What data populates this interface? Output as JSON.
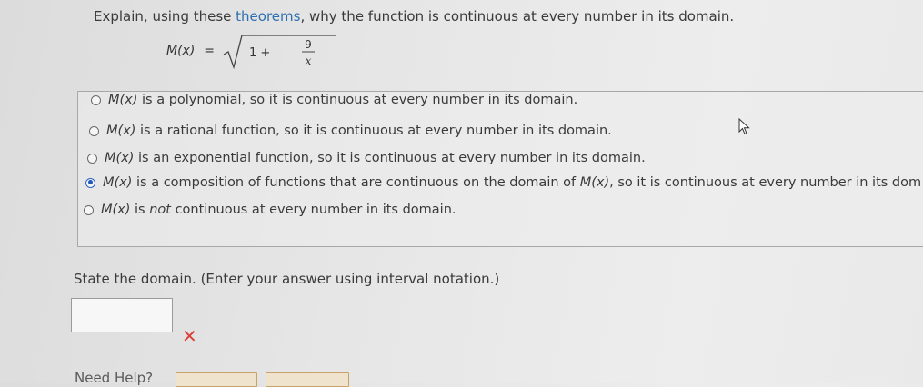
{
  "question": {
    "before_link": "Explain, using these ",
    "link": "theorems",
    "after_link": ", why the function is continuous at every number in its domain."
  },
  "formula": {
    "lhs": "M(x)",
    "equals": "=",
    "one_plus": "1 +",
    "numerator": "9",
    "denominator": "x"
  },
  "choices": [
    {
      "fn": "M(x)",
      "text": " is a polynomial, so it is continuous at every number in its domain.",
      "selected": false
    },
    {
      "fn": "M(x)",
      "text": " is a rational function, so it is continuous at every number in its domain.",
      "selected": false
    },
    {
      "fn": "M(x)",
      "text": " is an exponential function, so it is continuous at every number in its domain.",
      "selected": false
    },
    {
      "fn": "M(x)",
      "text_a": " is a composition of functions that are continuous on the domain of ",
      "fn2": "M(x)",
      "text_b": ", so it is continuous at every number in its dom",
      "selected": true
    },
    {
      "fn": "M(x)",
      "text_a": " is ",
      "em": "not",
      "text_b": " continuous at every number in its domain.",
      "selected": false
    }
  ],
  "domain_question": "State the domain. (Enter your answer using interval notation.)",
  "answer": {
    "value": "",
    "status_icon": "x-mark-icon",
    "status_color": "#d9413a",
    "mark": "✕"
  },
  "help": {
    "label": "Need Help?"
  },
  "colors": {
    "accent": "#2f6fb0",
    "radio_selected": "#1f57c5"
  }
}
